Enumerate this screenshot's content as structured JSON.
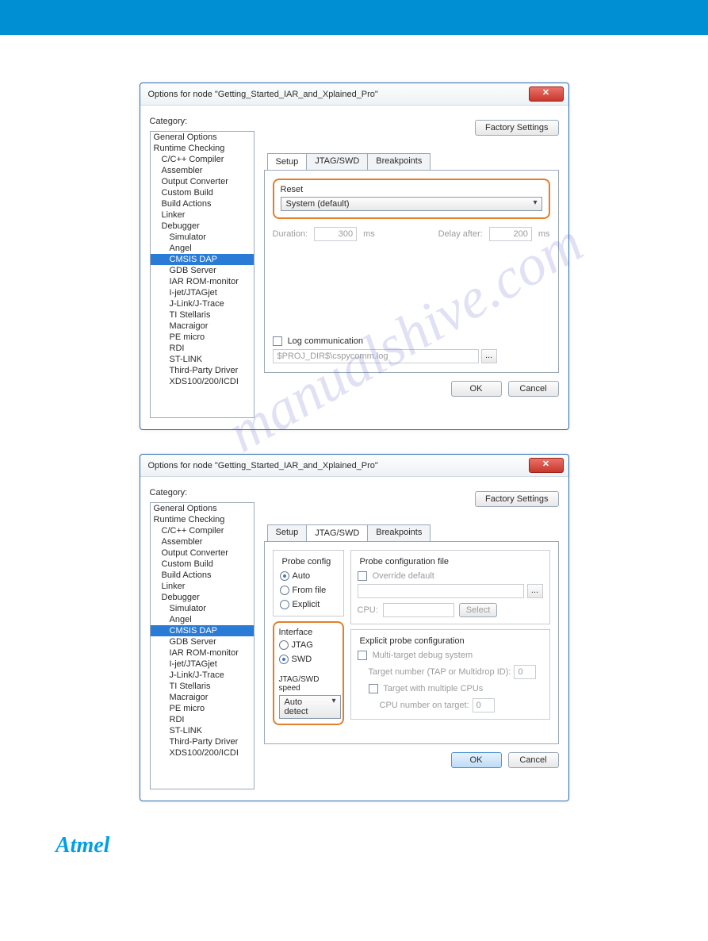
{
  "dialog1": {
    "title": "Options for node \"Getting_Started_IAR_and_Xplained_Pro\"",
    "category_label": "Category:",
    "factory_btn": "Factory Settings",
    "tabs": [
      "Setup",
      "JTAG/SWD",
      "Breakpoints"
    ],
    "reset_label": "Reset",
    "reset_value": "System (default)",
    "duration_label": "Duration:",
    "duration_value": "300",
    "duration_unit": "ms",
    "delay_label": "Delay after:",
    "delay_value": "200",
    "delay_unit": "ms",
    "log_label": "Log communication",
    "log_path": "$PROJ_DIR$\\cspycomm.log",
    "ok": "OK",
    "cancel": "Cancel"
  },
  "dialog2": {
    "title": "Options for node \"Getting_Started_IAR_and_Xplained_Pro\"",
    "category_label": "Category:",
    "factory_btn": "Factory Settings",
    "tabs": [
      "Setup",
      "JTAG/SWD",
      "Breakpoints"
    ],
    "probe_config_label": "Probe config",
    "probe_auto": "Auto",
    "probe_fromfile": "From file",
    "probe_explicit": "Explicit",
    "interface_label": "Interface",
    "iface_jtag": "JTAG",
    "iface_swd": "SWD",
    "speed_label": "JTAG/SWD speed",
    "speed_value": "Auto detect",
    "pcf_label": "Probe configuration file",
    "override_label": "Override default",
    "cpu_label": "CPU:",
    "select_btn": "Select",
    "epc_label": "Explicit probe configuration",
    "multi_label": "Multi-target debug system",
    "tap_label": "Target number (TAP or Multidrop ID):",
    "tap_value": "0",
    "multicpu_label": "Target with multiple CPUs",
    "cpunum_label": "CPU number on target:",
    "cpunum_value": "0",
    "ok": "OK",
    "cancel": "Cancel"
  },
  "categories": [
    {
      "label": "General Options",
      "indent": 0
    },
    {
      "label": "Runtime Checking",
      "indent": 0
    },
    {
      "label": "C/C++ Compiler",
      "indent": 1
    },
    {
      "label": "Assembler",
      "indent": 1
    },
    {
      "label": "Output Converter",
      "indent": 1
    },
    {
      "label": "Custom Build",
      "indent": 1
    },
    {
      "label": "Build Actions",
      "indent": 1
    },
    {
      "label": "Linker",
      "indent": 1
    },
    {
      "label": "Debugger",
      "indent": 1
    },
    {
      "label": "Simulator",
      "indent": 2
    },
    {
      "label": "Angel",
      "indent": 2
    },
    {
      "label": "CMSIS DAP",
      "indent": 2,
      "selected": true
    },
    {
      "label": "GDB Server",
      "indent": 2
    },
    {
      "label": "IAR ROM-monitor",
      "indent": 2
    },
    {
      "label": "I-jet/JTAGjet",
      "indent": 2
    },
    {
      "label": "J-Link/J-Trace",
      "indent": 2
    },
    {
      "label": "TI Stellaris",
      "indent": 2
    },
    {
      "label": "Macraigor",
      "indent": 2
    },
    {
      "label": "PE micro",
      "indent": 2
    },
    {
      "label": "RDI",
      "indent": 2
    },
    {
      "label": "ST-LINK",
      "indent": 2
    },
    {
      "label": "Third-Party Driver",
      "indent": 2
    },
    {
      "label": "XDS100/200/ICDI",
      "indent": 2
    }
  ],
  "brand": "Atmel",
  "watermark": "manualshive.com"
}
